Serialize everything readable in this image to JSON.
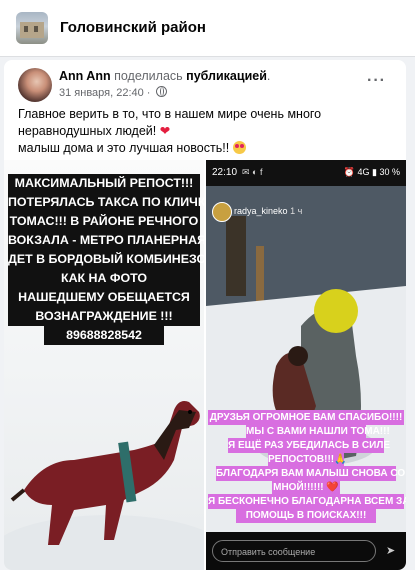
{
  "group": {
    "name": "Головинский район"
  },
  "post": {
    "author": "Ann Ann",
    "action": "поделилась",
    "object": "публикацией",
    "dot": ".",
    "date": "31 января, 22:40 ·",
    "more": "···",
    "text_lines": [
      "Главное верить в то, что в нашем мире очень много",
      "неравнодушных людей!",
      "малыш дома и это лучшая новость!!"
    ]
  },
  "left_photo": {
    "lines": [
      "МАКСИМАЛЬНЫЙ РЕПОСТ!!!",
      "ПОТЕРЯЛАСЬ ТАКСА ПО КЛИЧКЕ",
      "ТОМАС!!! В РАЙОНЕ РЕЧНОГО",
      "ВОКЗАЛА - МЕТРО ПЛАНЕРНАЯ",
      "ДЕТ В БОРДОВЫЙ КОМБИНЕЗО",
      "КАК НА ФОТО",
      "НАШЕДШЕМУ ОБЕЩАЕТСЯ",
      "ВОЗНАГРАЖДЕНИЕ !!!",
      "89688828542"
    ]
  },
  "right_photo": {
    "status_time": "22:10",
    "status_icons": "✉ ◐ f",
    "status_right": "⏰ 4G ▮ 30 %",
    "username": "radya_kineko",
    "username_suffix": "1 ч",
    "lines": [
      "ДРУЗЬЯ ОГРОМНОЕ ВАМ СПАСИБО!!!!",
      "МЫ С ВАМИ НАШЛИ ТОМА!!!",
      "Я ЕЩЁ РАЗ УБЕДИЛАСЬ В СИЛЕ",
      "РЕПОСТОВ!!!🙏",
      "БЛАГОДАРЯ ВАМ МАЛЫШ СНОВА СО",
      "МНОЙ!!!!!! ❤️",
      "Я БЕСКОНЕЧНО БЛАГОДАРНА ВСЕМ ЗА",
      "ПОМОЩЬ В ПОИСКАХ!!!"
    ],
    "reply_placeholder": "Отправить сообщение",
    "send_icon": "send-icon"
  },
  "colors": {
    "heart": "#e41e3f",
    "pink_banner": "#d86ee0",
    "link": "#050505"
  }
}
